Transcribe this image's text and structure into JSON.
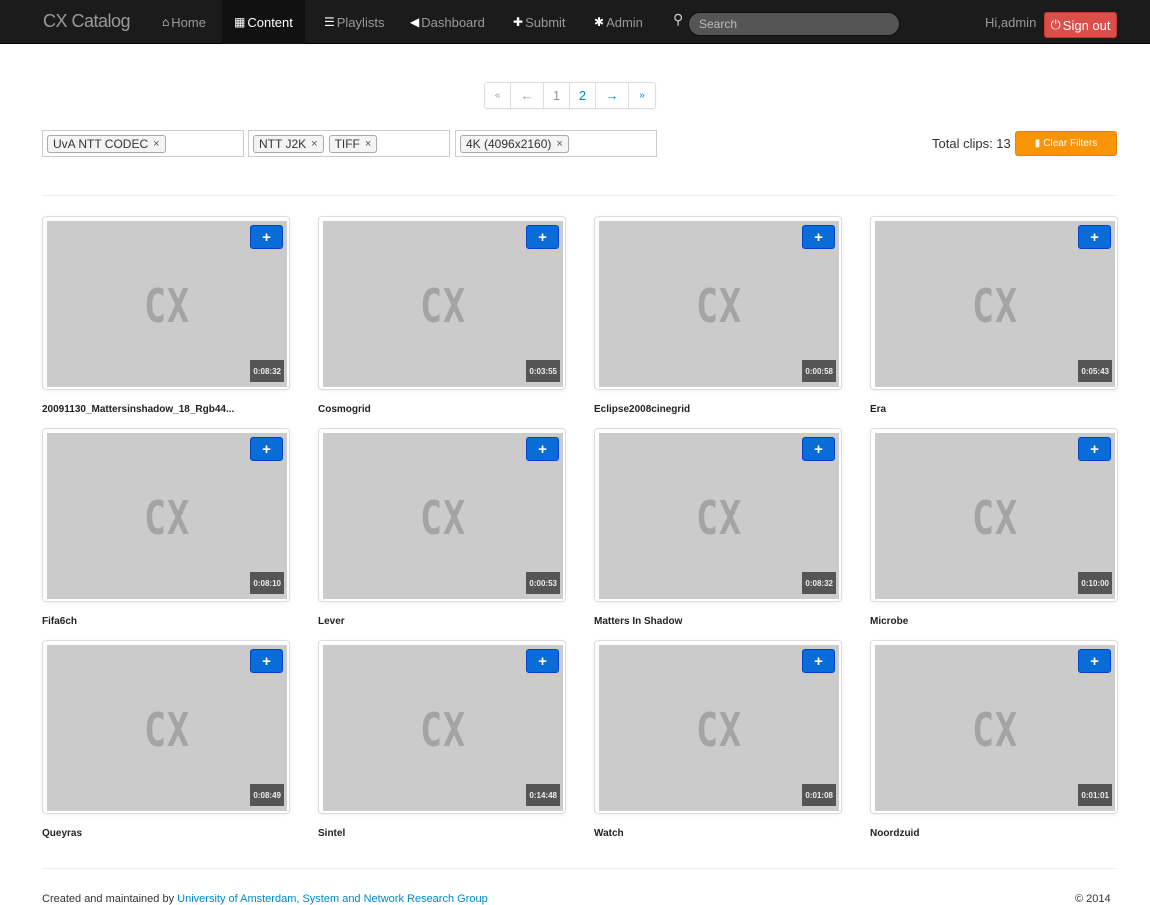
{
  "navbar": {
    "brand": "CX Catalog",
    "items": [
      {
        "label": "Home",
        "icon": "home-icon",
        "glyph": "⌂",
        "active": false
      },
      {
        "label": "Content",
        "icon": "film-icon",
        "glyph": "▦",
        "active": true
      },
      {
        "label": "Playlists",
        "icon": "list-icon",
        "glyph": "☰",
        "active": false
      },
      {
        "label": "Dashboard",
        "icon": "bullhorn-icon",
        "glyph": "◀",
        "active": false
      },
      {
        "label": "Submit",
        "icon": "plus-icon",
        "glyph": "✚",
        "active": false
      },
      {
        "label": "Admin",
        "icon": "cog-icon",
        "glyph": "✱",
        "active": false
      }
    ],
    "search_placeholder": "Search",
    "greeting": "Hi,admin",
    "signout_label": "Sign out"
  },
  "pagination": [
    "«",
    "←",
    "1",
    "2",
    "→",
    "»"
  ],
  "filters": {
    "groups": [
      [
        "UvA NTT CODEC"
      ],
      [
        "NTT J2K",
        "TIFF"
      ],
      [
        "4K (4096x2160)"
      ]
    ],
    "remove_glyph": "×",
    "total_clips": "Total clips: 13",
    "clear_label": "Clear Filters"
  },
  "clips": [
    {
      "title": "20091130_Mattersinshadow_18_Rgb44...",
      "duration": "0:08:32"
    },
    {
      "title": "Cosmogrid",
      "duration": "0:03:55"
    },
    {
      "title": "Eclipse2008cinegrid",
      "duration": "0:00:58"
    },
    {
      "title": "Era",
      "duration": "0:05:43"
    },
    {
      "title": "Fifa6ch",
      "duration": "0:08:10"
    },
    {
      "title": "Lever",
      "duration": "0:00:53"
    },
    {
      "title": "Matters In Shadow",
      "duration": "0:08:32"
    },
    {
      "title": "Microbe",
      "duration": "0:10:00"
    },
    {
      "title": "Queyras",
      "duration": "0:08:49"
    },
    {
      "title": "Sintel",
      "duration": "0:14:48"
    },
    {
      "title": "Watch",
      "duration": "0:01:08"
    },
    {
      "title": "Noordzuid",
      "duration": "0:01:01"
    }
  ],
  "thumb_text": "CX",
  "add_glyph": "+",
  "footer": {
    "prefix": "Created and maintained by ",
    "link": "University of Amsterdam, System and Network Research Group",
    "copyright": "© 2014"
  },
  "colors": {
    "navbar": "#1b1b1b",
    "signout": "#da4f49",
    "clear": "#f89406",
    "add": "#0a6cd6",
    "link": "#0088cc"
  }
}
